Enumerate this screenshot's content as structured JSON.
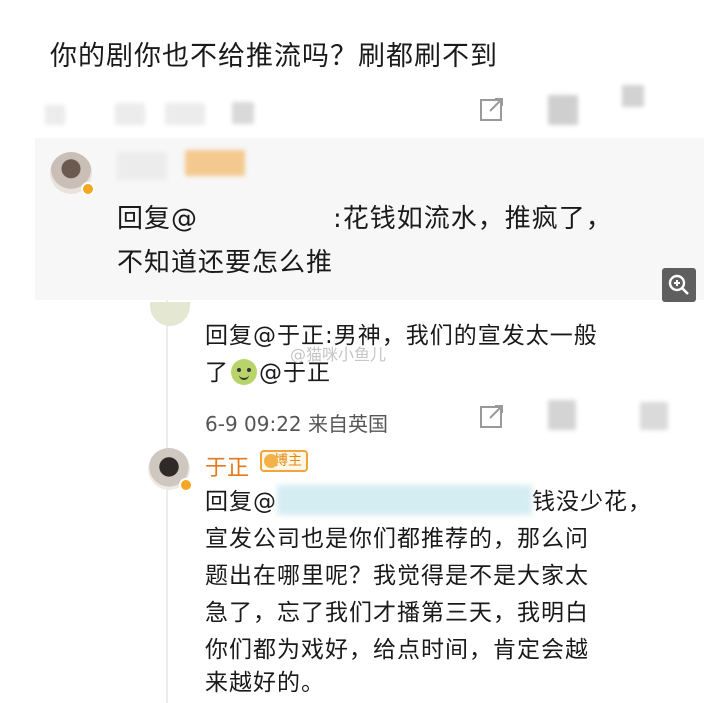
{
  "post": {
    "question": "你的剧你也不给推流吗？刷都刷不到"
  },
  "comment1": {
    "reply_prefix": "回复@",
    "reply_rest": ":花钱如流水，推疯了，",
    "reply_line2": "不知道还要怎么推"
  },
  "comment2": {
    "line1": "回复@于正:男神，我们的宣发太一般",
    "line2_pre": "了",
    "line2_post": "@于正",
    "meta": "6-9 09:22 来自英国",
    "watermark": "@猫咪小鱼儿"
  },
  "comment3": {
    "author": "于正",
    "badge": "博主",
    "reply_prefix": "回复@",
    "reply_rest": "钱没少花，",
    "lines": [
      "宣发公司也是你们都推荐的，那么问",
      "题出在哪里呢？我觉得是不是大家太",
      "急了，忘了我们才播第三天，我明白",
      "你们都为戏好，给点时间，肯定会越",
      "来越好的。"
    ]
  },
  "icons": {
    "share": "share-icon",
    "comment": "comment-icon",
    "zoom": "zoom-in-icon",
    "verified": "verified-icon",
    "emoji": "emoji-icon",
    "badge": "crown-icon"
  },
  "colors": {
    "accent_orange": "#e07b1a",
    "zoom_button": "#5f5f5f"
  }
}
